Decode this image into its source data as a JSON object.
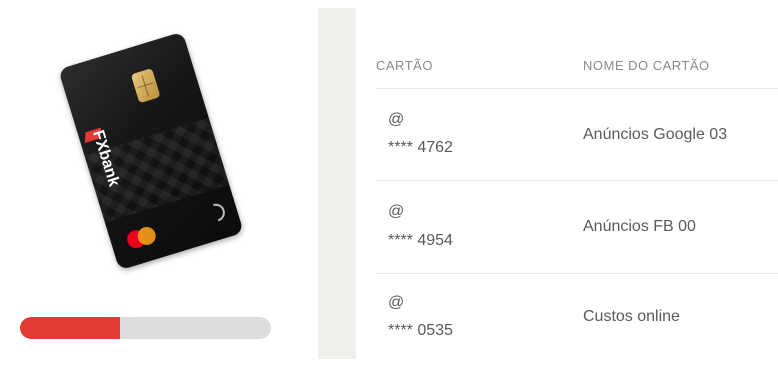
{
  "card_image": {
    "brand_text": "FXbank",
    "network_icon": "mastercard-icon",
    "contactless_icon": "contactless-icon",
    "colors": {
      "card": "#111111",
      "accent": "#e53935"
    }
  },
  "progress": {
    "fraction": 0.4,
    "fill_color": "#e53935",
    "track_color": "#dcdcdc"
  },
  "table": {
    "headers": {
      "card": "CARTÃO",
      "name": "NOME DO CARTÃO"
    },
    "rows": [
      {
        "at": "@",
        "number": "**** 4762",
        "name": "Anúncios Google 03"
      },
      {
        "at": "@",
        "number": "**** 4954",
        "name": "Anúncios FB 00"
      },
      {
        "at": "@",
        "number": "**** 0535",
        "name": "Custos online"
      }
    ]
  }
}
